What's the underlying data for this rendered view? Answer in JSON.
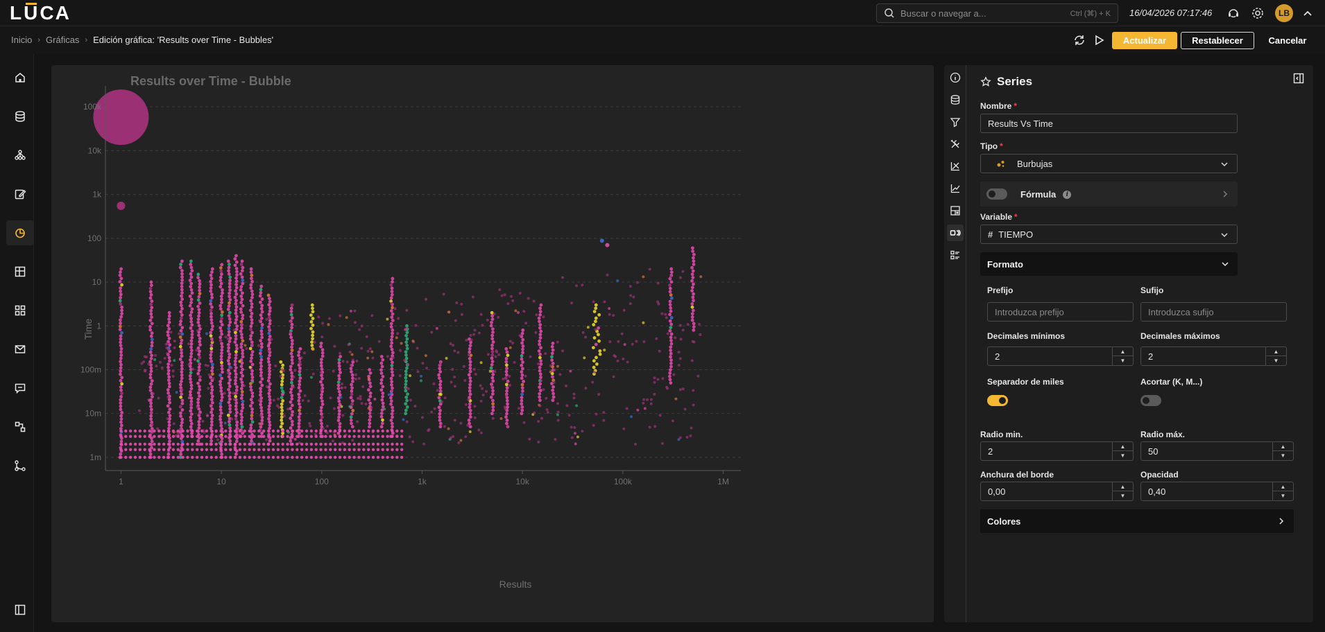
{
  "app": {
    "logo": [
      "L",
      "U",
      "CA"
    ],
    "search_placeholder": "Buscar o navegar a...",
    "search_shortcut": "Ctrl (⌘) + K",
    "datetime": "16/04/2026 07:17:46",
    "avatar_initials": "LB"
  },
  "breadcrumb": [
    "Inicio",
    "Gráficas",
    "Edición gráfica: 'Results over Time - Bubbles'"
  ],
  "actions": {
    "update": "Actualizar",
    "reset": "Restablecer",
    "cancel": "Cancelar"
  },
  "sidebar": {
    "icons": [
      "home-icon",
      "database-icon",
      "hierarchy-icon",
      "edit-icon",
      "chart-pie-icon",
      "dashboard-icon",
      "grid-icon",
      "mail-icon",
      "chat-icon",
      "flow-icon",
      "branch-icon"
    ],
    "active": "chart-pie-icon",
    "bottom_icon": "collapse-sidebar-icon"
  },
  "series_panel": {
    "tabs": [
      "info-icon",
      "database-icon",
      "filter-icon",
      "tools-icon",
      "axis-icon",
      "line-chart-icon",
      "layout-icon",
      "series-icon",
      "list-settings-icon"
    ],
    "active_tab": "series-icon",
    "title": "Series",
    "name_label": "Nombre",
    "name_value": "Results Vs Time",
    "type_label": "Tipo",
    "type_value": "Burbujas",
    "formula_label": "Fórmula",
    "formula_on": false,
    "variable_label": "Variable",
    "variable_value": "TIEMPO",
    "format_section": "Formato",
    "prefix_label": "Prefijo",
    "prefix_placeholder": "Introduzca prefijo",
    "suffix_label": "Sufijo",
    "suffix_placeholder": "Introduzca sufijo",
    "min_decimals_label": "Decimales mínimos",
    "min_decimals_value": "2",
    "max_decimals_label": "Decimales máximos",
    "max_decimals_value": "2",
    "thousands_label": "Separador de miles",
    "thousands_on": true,
    "shorten_label": "Acortar (K, M...)",
    "shorten_on": false,
    "radius_min_label": "Radio min.",
    "radius_min_value": "2",
    "radius_max_label": "Radio máx.",
    "radius_max_value": "50",
    "border_width_label": "Anchura del borde",
    "border_width_value": "0,00",
    "opacity_label": "Opacidad",
    "opacity_value": "0,40",
    "colors_section": "Colores",
    "accent_color": "#f5b731"
  },
  "chart_data": {
    "type": "scatter",
    "subtype": "bubble",
    "title": "Results over Time - Bubble",
    "xlabel": "Results",
    "ylabel": "Time",
    "x_scale": "log",
    "y_scale": "log",
    "xlim": [
      0.7,
      1500000
    ],
    "ylim": [
      0.0005,
      300000
    ],
    "x_ticks": [
      1,
      10,
      100,
      1000,
      10000,
      100000,
      1000000
    ],
    "x_tick_labels": [
      "1",
      "10",
      "100",
      "1k",
      "10k",
      "100k",
      "1M"
    ],
    "y_ticks": [
      0.001,
      0.01,
      0.1,
      1,
      10,
      100,
      1000,
      10000,
      100000
    ],
    "y_tick_labels": [
      "1m",
      "10m",
      "100m",
      "1",
      "10",
      "100",
      "1k",
      "10k",
      "100k"
    ],
    "grid": "horizontal dashed",
    "legend": "none",
    "colors": [
      "#e84bb0",
      "#a8327e",
      "#f2e12e",
      "#2fb07a",
      "#3d6fd6",
      "#e07a3a"
    ],
    "point_opacity": 0.4,
    "highlight_points": [
      {
        "x": 1,
        "y": 58000,
        "r": 40,
        "color": "#a8327e"
      },
      {
        "x": 1,
        "y": 550,
        "r": 6,
        "color": "#a8327e"
      },
      {
        "x": 62000,
        "y": 88,
        "r": 3,
        "color": "#3d6fd6"
      },
      {
        "x": 70000,
        "y": 70,
        "r": 3,
        "color": "#e84bb0"
      }
    ],
    "columns": [
      {
        "x": 1,
        "y_min": 0.001,
        "y_max": 20,
        "color": "#e84bb0"
      },
      {
        "x": 2,
        "y_min": 0.001,
        "y_max": 10,
        "color": "#e84bb0"
      },
      {
        "x": 3,
        "y_min": 0.001,
        "y_max": 2,
        "color": "#e84bb0"
      },
      {
        "x": 4,
        "y_min": 0.001,
        "y_max": 30,
        "color": "#e84bb0"
      },
      {
        "x": 5,
        "y_min": 0.003,
        "y_max": 30,
        "color": "#e84bb0"
      },
      {
        "x": 6,
        "y_min": 0.002,
        "y_max": 15,
        "color": "#e84bb0"
      },
      {
        "x": 8,
        "y_min": 0.002,
        "y_max": 20,
        "color": "#e84bb0"
      },
      {
        "x": 10,
        "y_min": 0.001,
        "y_max": 25,
        "color": "#e84bb0"
      },
      {
        "x": 12,
        "y_min": 0.002,
        "y_max": 30,
        "color": "#e84bb0"
      },
      {
        "x": 14,
        "y_min": 0.001,
        "y_max": 40,
        "color": "#e84bb0"
      },
      {
        "x": 16,
        "y_min": 0.003,
        "y_max": 30,
        "color": "#e84bb0"
      },
      {
        "x": 20,
        "y_min": 0.002,
        "y_max": 20,
        "color": "#e84bb0"
      },
      {
        "x": 25,
        "y_min": 0.003,
        "y_max": 8,
        "color": "#e84bb0"
      },
      {
        "x": 30,
        "y_min": 0.002,
        "y_max": 5,
        "color": "#e84bb0"
      },
      {
        "x": 40,
        "y_min": 0.003,
        "y_max": 0.15,
        "color": "#f2e12e"
      },
      {
        "x": 50,
        "y_min": 0.002,
        "y_max": 3,
        "color": "#e84bb0"
      },
      {
        "x": 60,
        "y_min": 0.003,
        "y_max": 0.3,
        "color": "#e84bb0"
      },
      {
        "x": 80,
        "y_min": 0.3,
        "y_max": 3,
        "color": "#f2e12e"
      },
      {
        "x": 100,
        "y_min": 0.003,
        "y_max": 0.4,
        "color": "#e84bb0"
      },
      {
        "x": 150,
        "y_min": 0.003,
        "y_max": 0.2,
        "color": "#e84bb0"
      },
      {
        "x": 200,
        "y_min": 0.005,
        "y_max": 0.15,
        "color": "#e84bb0"
      },
      {
        "x": 300,
        "y_min": 0.005,
        "y_max": 0.1,
        "color": "#e84bb0"
      },
      {
        "x": 400,
        "y_min": 0.005,
        "y_max": 0.2,
        "color": "#e84bb0"
      },
      {
        "x": 500,
        "y_min": 0.003,
        "y_max": 12,
        "color": "#e84bb0"
      },
      {
        "x": 700,
        "y_min": 0.01,
        "y_max": 1,
        "color": "#2fb07a"
      },
      {
        "x": 1500,
        "y_min": 0.005,
        "y_max": 0.15,
        "color": "#e84bb0"
      },
      {
        "x": 3000,
        "y_min": 0.005,
        "y_max": 0.5,
        "color": "#e84bb0"
      },
      {
        "x": 5000,
        "y_min": 0.01,
        "y_max": 2,
        "color": "#e84bb0"
      },
      {
        "x": 7000,
        "y_min": 0.005,
        "y_max": 0.3,
        "color": "#e84bb0"
      },
      {
        "x": 10000,
        "y_min": 0.01,
        "y_max": 0.8,
        "color": "#e84bb0"
      },
      {
        "x": 15000,
        "y_min": 0.02,
        "y_max": 3,
        "color": "#e84bb0"
      },
      {
        "x": 20000,
        "y_min": 0.02,
        "y_max": 0.4,
        "color": "#e84bb0"
      },
      {
        "x": 55000,
        "y_min": 0.08,
        "y_max": 3,
        "color": "#f2e12e"
      },
      {
        "x": 300000,
        "y_min": 0.05,
        "y_max": 20,
        "color": "#e84bb0"
      },
      {
        "x": 500000,
        "y_min": 0.8,
        "y_max": 60,
        "color": "#e84bb0"
      }
    ]
  }
}
